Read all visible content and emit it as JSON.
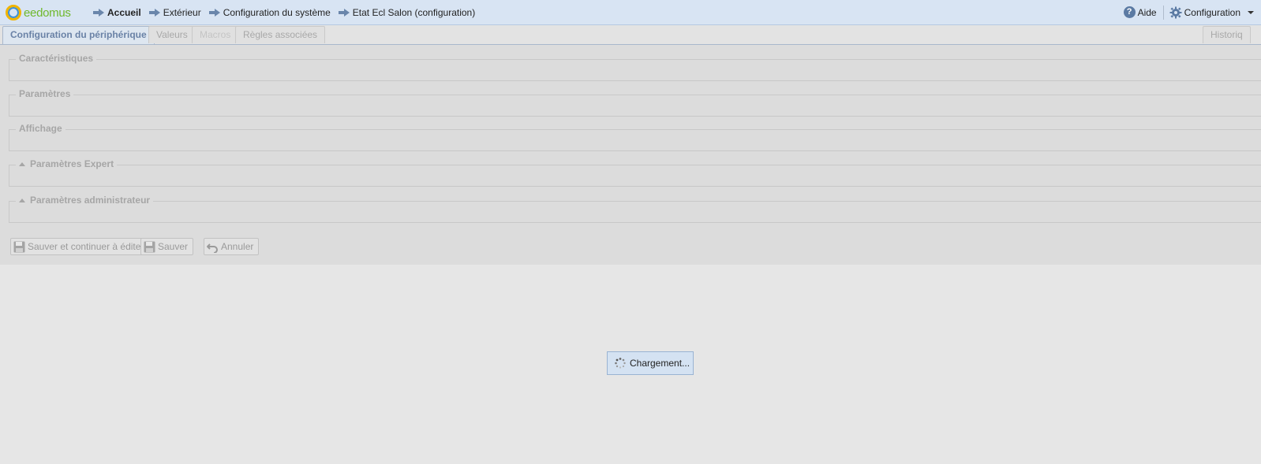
{
  "header": {
    "logo_text": "eedomus",
    "breadcrumbs": [
      "Accueil",
      "Extérieur",
      "Configuration du système",
      "Etat Ecl Salon (configuration)"
    ],
    "help_label": "Aide",
    "config_label": "Configuration"
  },
  "tabs": [
    {
      "label": "Configuration du périphérique",
      "state": "active"
    },
    {
      "label": "Valeurs",
      "state": "normal"
    },
    {
      "label": "Macros",
      "state": "disabled"
    },
    {
      "label": "Règles associées",
      "state": "normal"
    },
    {
      "label": "Historiq",
      "state": "normal"
    }
  ],
  "sections": [
    {
      "label": "Caractéristiques",
      "collapsible": false
    },
    {
      "label": "Paramètres",
      "collapsible": false
    },
    {
      "label": "Affichage",
      "collapsible": false
    },
    {
      "label": "Paramètres Expert",
      "collapsible": true
    },
    {
      "label": "Paramètres administrateur",
      "collapsible": true
    }
  ],
  "buttons": {
    "save_continue": "Sauver et continuer à éditer",
    "save": "Sauver",
    "cancel": "Annuler"
  },
  "loading": {
    "label": "Chargement..."
  },
  "colors": {
    "header_bg": "#d8e4f3",
    "active_tab_text": "#6a82a6",
    "logo_green": "#6fb82c",
    "loading_bg": "#d4e2f2"
  }
}
